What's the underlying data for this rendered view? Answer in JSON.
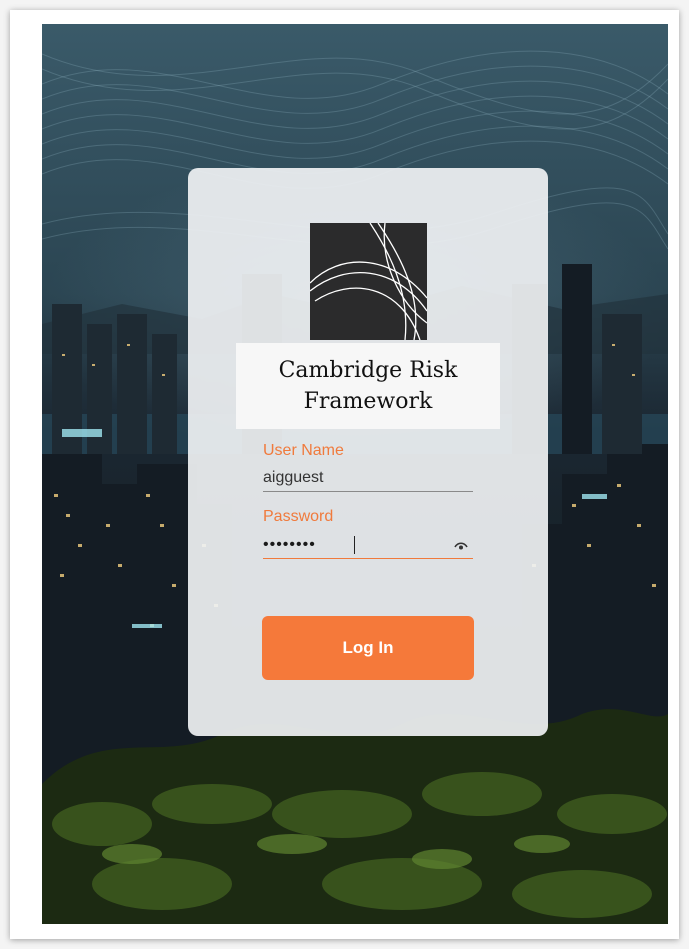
{
  "brand": {
    "title": "Cambridge Risk Framework",
    "logo_icon": "abstract-curves-logo"
  },
  "form": {
    "username_label": "User Name",
    "username_value": "aigguest",
    "password_label": "Password",
    "password_value": "••••••••",
    "reveal_icon": "eye-icon",
    "submit_label": "Log In"
  },
  "colors": {
    "accent": "#f5793a",
    "label": "#f07a3c",
    "card": "#f0f2f4"
  }
}
